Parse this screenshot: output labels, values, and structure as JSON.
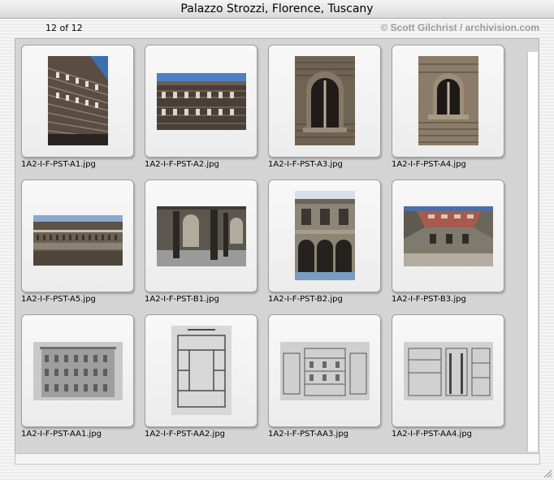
{
  "window": {
    "title": "Palazzo Strozzi, Florence, Tuscany"
  },
  "infobar": {
    "counter": "12 of 12",
    "credit": "© Scott Gilchrist / archivision.com"
  },
  "thumbnails": [
    {
      "filename": "1A2-I-F-PST-A1.jpg"
    },
    {
      "filename": "1A2-I-F-PST-A2.jpg"
    },
    {
      "filename": "1A2-I-F-PST-A3.jpg"
    },
    {
      "filename": "1A2-I-F-PST-A4.jpg"
    },
    {
      "filename": "1A2-I-F-PST-A5.jpg"
    },
    {
      "filename": "1A2-I-F-PST-B1.jpg"
    },
    {
      "filename": "1A2-I-F-PST-B2.jpg"
    },
    {
      "filename": "1A2-I-F-PST-B3.jpg"
    },
    {
      "filename": "1A2-I-F-PST-AA1.jpg"
    },
    {
      "filename": "1A2-I-F-PST-AA2.jpg"
    },
    {
      "filename": "1A2-I-F-PST-AA3.jpg"
    },
    {
      "filename": "1A2-I-F-PST-AA4.jpg"
    }
  ]
}
